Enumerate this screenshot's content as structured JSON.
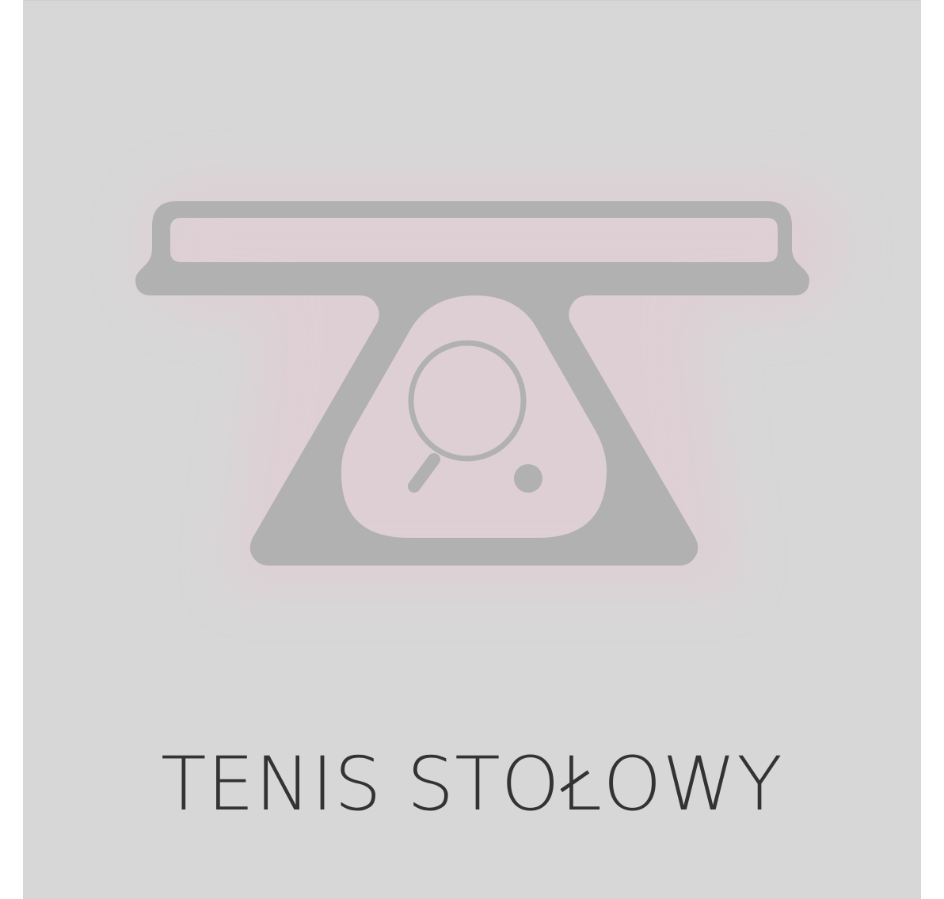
{
  "card": {
    "title": "TENIS STOŁOWY",
    "icon": "table-tennis-table-icon"
  },
  "colors": {
    "background": "#d7d7d7",
    "glow": "#e4c9d2",
    "icon": "#b1b1b1",
    "text": "#333333"
  }
}
